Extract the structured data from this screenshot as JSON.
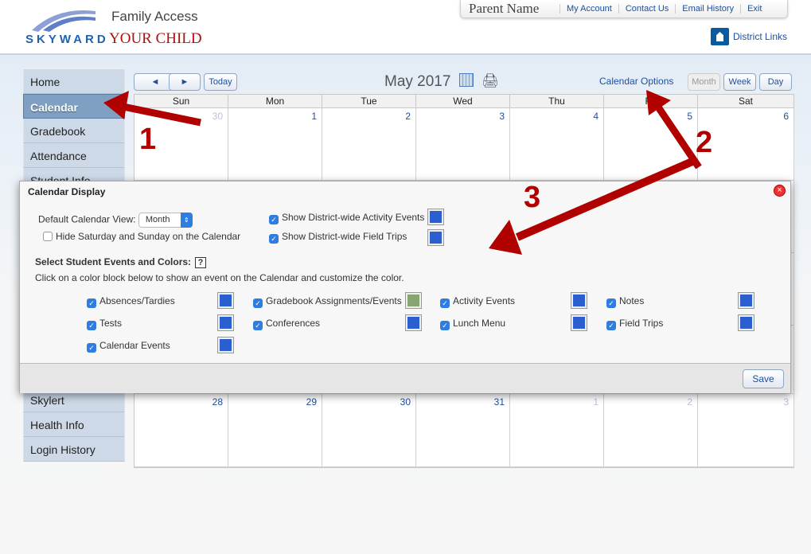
{
  "header": {
    "logo_text": "SKYWARD",
    "app_title": "Family Access",
    "student_name": "YOUR CHILD",
    "parent_name": "Parent Name",
    "links": [
      "My Account",
      "Contact Us",
      "Email History",
      "Exit"
    ],
    "district_links": "District Links"
  },
  "sidebar": {
    "items": [
      "Home",
      "Calendar",
      "Gradebook",
      "Attendance",
      "Student Info"
    ],
    "items_bottom": [
      "Skylert",
      "Health Info",
      "Login History"
    ],
    "active": "Calendar"
  },
  "calendar": {
    "prev": "◄",
    "next": "►",
    "today": "Today",
    "month_title": "May 2017",
    "options_link": "Calendar Options",
    "views": [
      "Month",
      "Week",
      "Day"
    ],
    "selected_view": "Month",
    "weekdays": [
      "Sun",
      "Mon",
      "Tue",
      "Wed",
      "Thu",
      "Fri",
      "Sat"
    ],
    "first_week": [
      "30",
      "1",
      "2",
      "3",
      "4",
      "5",
      "6"
    ],
    "last_week": [
      "28",
      "29",
      "30",
      "31",
      "1",
      "2",
      "3"
    ]
  },
  "modal": {
    "title": "Calendar Display",
    "default_view_label": "Default Calendar View:",
    "default_view_value": "Month",
    "hide_weekend_label": "Hide Saturday and Sunday on the Calendar",
    "hide_weekend_checked": false,
    "district_activity_label": "Show District-wide Activity Events",
    "district_trips_label": "Show District-wide Field Trips",
    "section_title": "Select Student Events and Colors:",
    "help": "?",
    "instructions": "Click on a color block below to show an event on the Calendar and customize the color.",
    "events": [
      {
        "label": "Absences/Tardies",
        "checked": true,
        "color": "#2b5fd0"
      },
      {
        "label": "Gradebook Assignments/Events",
        "checked": true,
        "color": "#86a572"
      },
      {
        "label": "Activity Events",
        "checked": true,
        "color": "#2b5fd0"
      },
      {
        "label": "Notes",
        "checked": true,
        "color": "#2b5fd0"
      },
      {
        "label": "Tests",
        "checked": true,
        "color": "#2b5fd0"
      },
      {
        "label": "Conferences",
        "checked": true,
        "color": "#2b5fd0"
      },
      {
        "label": "Lunch Menu",
        "checked": true,
        "color": "#2b5fd0"
      },
      {
        "label": "Field Trips",
        "checked": true,
        "color": "#2b5fd0"
      },
      {
        "label": "Calendar Events",
        "checked": true,
        "color": "#2b5fd0"
      }
    ],
    "save": "Save"
  },
  "annotations": [
    "1",
    "2",
    "3"
  ],
  "colors": {
    "annotation": "#b00000",
    "link": "#1e4fa0",
    "event_blue": "#2b5fd0"
  }
}
